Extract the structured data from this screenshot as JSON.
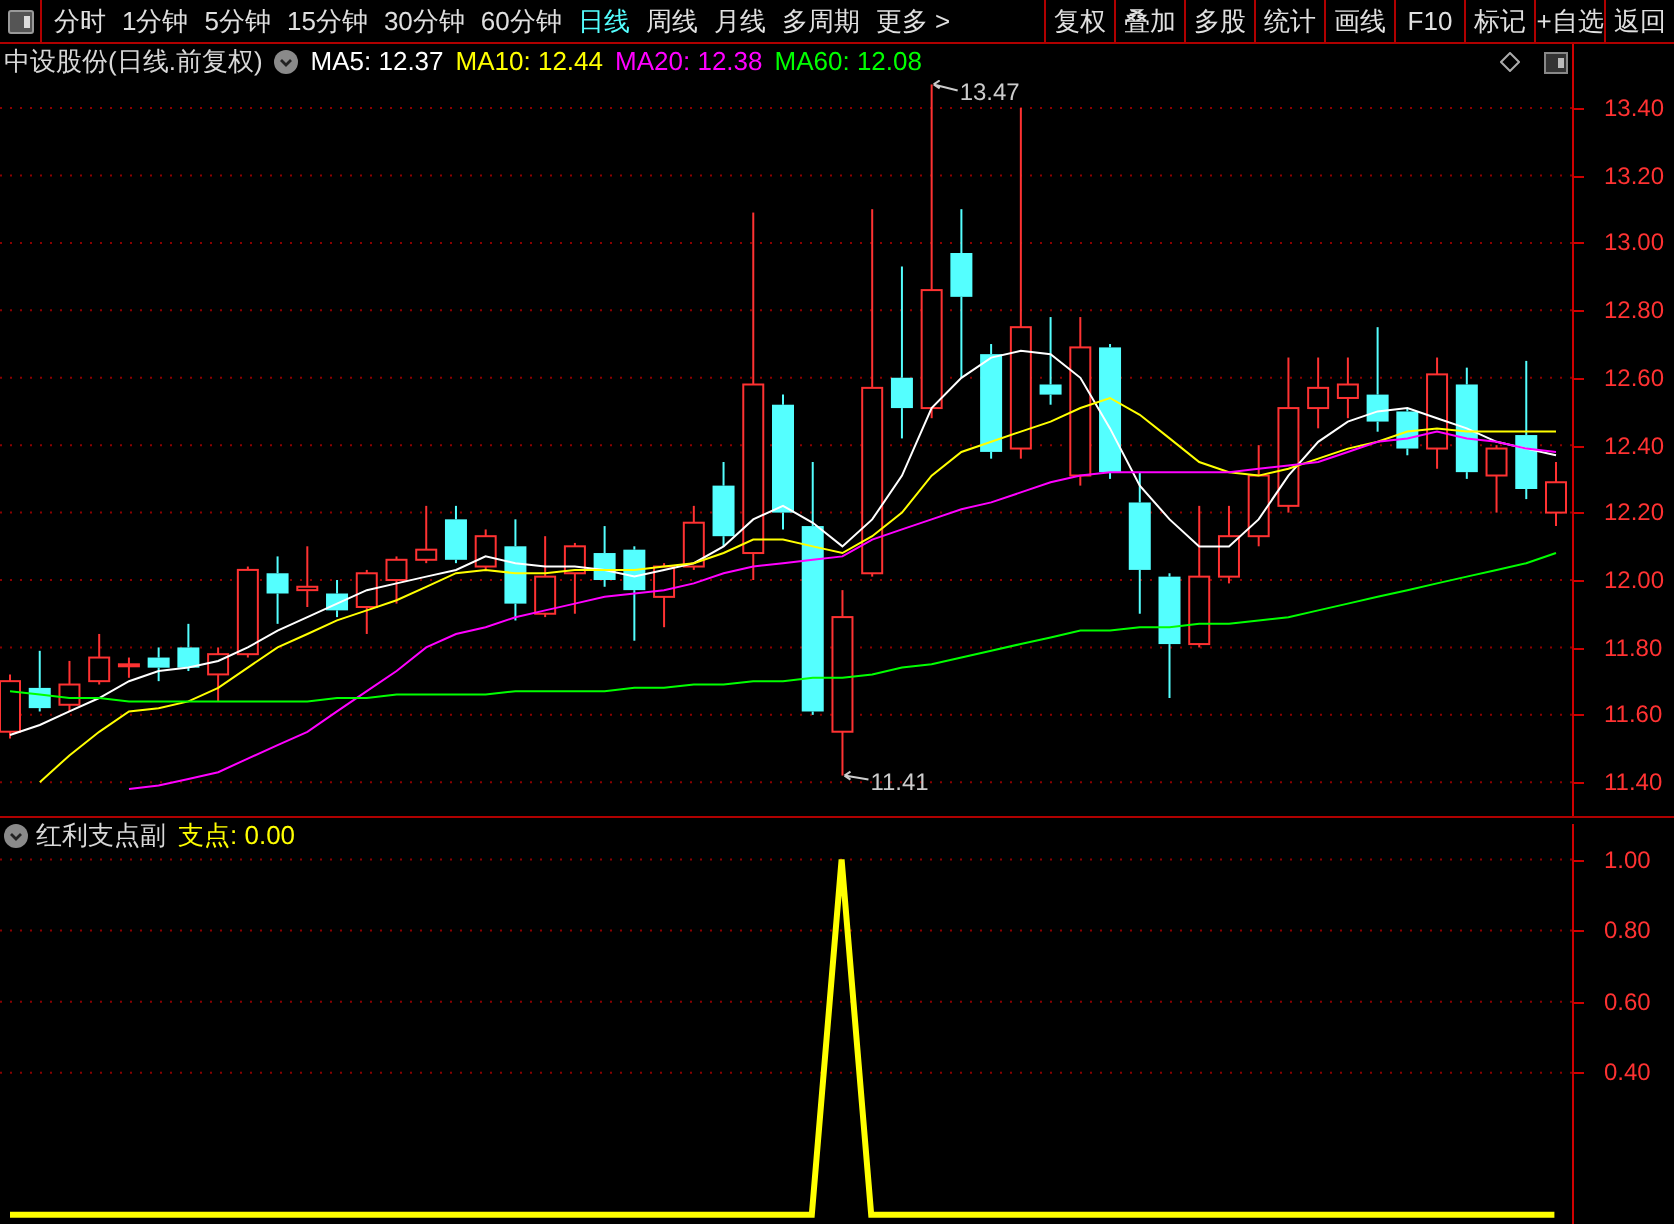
{
  "toolbar": {
    "periods": [
      {
        "label": "分时",
        "selected": false
      },
      {
        "label": "1分钟",
        "selected": false
      },
      {
        "label": "5分钟",
        "selected": false
      },
      {
        "label": "15分钟",
        "selected": false
      },
      {
        "label": "30分钟",
        "selected": false
      },
      {
        "label": "60分钟",
        "selected": false
      },
      {
        "label": "日线",
        "selected": true
      },
      {
        "label": "周线",
        "selected": false
      },
      {
        "label": "月线",
        "selected": false
      },
      {
        "label": "多周期",
        "selected": false
      },
      {
        "label": "更多 >",
        "selected": false
      }
    ],
    "buttons": [
      "复权",
      "叠加",
      "多股",
      "统计",
      "画线",
      "F10",
      "标记",
      "+自选",
      "返回"
    ]
  },
  "price_chart": {
    "title": "中设股份(日线.前复权)",
    "legend_values": [
      ": 12.37",
      ": 12.44",
      ": 12.38",
      ": 12.08"
    ],
    "high_label": "13.47",
    "low_label": "11.41",
    "chart_data": {
      "type": "candlestick",
      "ylim": [
        11.3,
        13.59
      ],
      "grid": true,
      "categories": [
        null,
        null,
        null,
        null,
        null,
        null,
        null,
        null,
        null,
        null,
        null,
        null,
        null,
        null,
        null,
        null,
        null,
        null,
        null,
        null,
        null,
        null,
        null,
        null,
        null,
        null,
        null,
        null,
        null,
        null,
        null,
        null,
        null,
        null,
        null,
        null,
        null,
        null,
        null,
        null,
        null,
        null,
        null,
        null,
        null,
        null,
        null,
        null,
        null,
        null,
        null,
        null,
        null
      ],
      "ohlc": [
        [
          11.55,
          11.72,
          11.53,
          11.7
        ],
        [
          11.68,
          11.79,
          11.61,
          11.62
        ],
        [
          11.63,
          11.76,
          11.61,
          11.69
        ],
        [
          11.7,
          11.84,
          11.69,
          11.77
        ],
        [
          11.75,
          11.77,
          11.71,
          11.75
        ],
        [
          11.77,
          11.8,
          11.7,
          11.74
        ],
        [
          11.8,
          11.87,
          11.73,
          11.74
        ],
        [
          11.72,
          11.8,
          11.64,
          11.78
        ],
        [
          11.78,
          12.04,
          11.77,
          12.03
        ],
        [
          12.02,
          12.07,
          11.87,
          11.96
        ],
        [
          11.97,
          12.1,
          11.92,
          11.98
        ],
        [
          11.96,
          12.0,
          11.89,
          11.91
        ],
        [
          11.92,
          12.03,
          11.84,
          12.02
        ],
        [
          12.0,
          12.07,
          11.93,
          12.06
        ],
        [
          12.06,
          12.22,
          12.05,
          12.09
        ],
        [
          12.18,
          12.22,
          12.05,
          12.06
        ],
        [
          12.04,
          12.15,
          12.03,
          12.13
        ],
        [
          12.1,
          12.18,
          11.88,
          11.93
        ],
        [
          11.9,
          12.13,
          11.89,
          12.01
        ],
        [
          12.02,
          12.11,
          11.9,
          12.1
        ],
        [
          12.08,
          12.16,
          11.98,
          12.0
        ],
        [
          12.09,
          12.1,
          11.82,
          11.97
        ],
        [
          11.95,
          12.05,
          11.86,
          12.04
        ],
        [
          12.04,
          12.22,
          12.03,
          12.17
        ],
        [
          12.28,
          12.35,
          12.1,
          12.13
        ],
        [
          12.08,
          13.09,
          12.0,
          12.58
        ],
        [
          12.52,
          12.55,
          12.15,
          12.2
        ],
        [
          12.16,
          12.35,
          11.6,
          11.61
        ],
        [
          11.55,
          11.97,
          11.42,
          11.89
        ],
        [
          12.02,
          13.1,
          12.01,
          12.57
        ],
        [
          12.6,
          12.93,
          12.42,
          12.51
        ],
        [
          12.51,
          13.47,
          12.48,
          12.86
        ],
        [
          12.97,
          13.1,
          12.6,
          12.84
        ],
        [
          12.67,
          12.7,
          12.36,
          12.38
        ],
        [
          12.39,
          13.4,
          12.36,
          12.75
        ],
        [
          12.58,
          12.78,
          12.52,
          12.55
        ],
        [
          12.31,
          12.78,
          12.28,
          12.69
        ],
        [
          12.69,
          12.7,
          12.3,
          12.32
        ],
        [
          12.23,
          12.32,
          11.9,
          12.03
        ],
        [
          12.01,
          12.02,
          11.65,
          11.81
        ],
        [
          11.81,
          12.22,
          11.8,
          12.01
        ],
        [
          12.01,
          12.22,
          11.99,
          12.13
        ],
        [
          12.13,
          12.4,
          12.1,
          12.31
        ],
        [
          12.22,
          12.66,
          12.2,
          12.51
        ],
        [
          12.51,
          12.66,
          12.45,
          12.57
        ],
        [
          12.54,
          12.66,
          12.48,
          12.58
        ],
        [
          12.55,
          12.75,
          12.44,
          12.47
        ],
        [
          12.5,
          12.51,
          12.37,
          12.39
        ],
        [
          12.39,
          12.66,
          12.33,
          12.61
        ],
        [
          12.58,
          12.63,
          12.3,
          12.32
        ],
        [
          12.31,
          12.4,
          12.2,
          12.39
        ],
        [
          12.43,
          12.65,
          12.24,
          12.27
        ],
        [
          12.2,
          12.35,
          12.16,
          12.29
        ]
      ],
      "series": [
        {
          "name": "MA5",
          "type": "line",
          "color": "#ffffff",
          "values": [
            11.54,
            11.57,
            11.61,
            11.65,
            11.7,
            11.73,
            11.74,
            11.76,
            11.8,
            11.85,
            11.89,
            11.93,
            11.97,
            11.99,
            12.01,
            12.03,
            12.07,
            12.05,
            12.04,
            12.04,
            12.03,
            12.01,
            12.03,
            12.05,
            12.1,
            12.18,
            12.22,
            12.17,
            12.1,
            12.18,
            12.31,
            12.51,
            12.6,
            12.66,
            12.68,
            12.67,
            12.6,
            12.45,
            12.28,
            12.18,
            12.1,
            12.1,
            12.18,
            12.31,
            12.41,
            12.47,
            12.5,
            12.51,
            12.48,
            12.45,
            12.41,
            12.39,
            12.37
          ]
        },
        {
          "name": "MA10",
          "type": "line",
          "color": "#ffff00",
          "values": [
            null,
            11.4,
            11.48,
            11.55,
            11.61,
            11.62,
            11.64,
            11.68,
            11.74,
            11.8,
            11.84,
            11.88,
            11.91,
            11.94,
            11.98,
            12.02,
            12.03,
            12.02,
            12.02,
            12.03,
            12.03,
            12.03,
            12.04,
            12.05,
            12.08,
            12.12,
            12.12,
            12.1,
            12.08,
            12.13,
            12.2,
            12.31,
            12.38,
            12.41,
            12.44,
            12.47,
            12.51,
            12.54,
            12.49,
            12.42,
            12.35,
            12.32,
            12.31,
            12.33,
            12.36,
            12.39,
            12.41,
            12.44,
            12.45,
            12.44,
            12.44,
            12.44,
            12.44
          ]
        },
        {
          "name": "MA20",
          "type": "line",
          "color": "#ff00ff",
          "values": [
            null,
            null,
            null,
            null,
            11.38,
            11.39,
            11.41,
            11.43,
            11.47,
            11.51,
            11.55,
            11.61,
            11.67,
            11.73,
            11.8,
            11.84,
            11.86,
            11.89,
            11.91,
            11.93,
            11.95,
            11.96,
            11.97,
            11.99,
            12.02,
            12.04,
            12.05,
            12.06,
            12.07,
            12.12,
            12.15,
            12.18,
            12.21,
            12.23,
            12.26,
            12.29,
            12.31,
            12.32,
            12.32,
            12.32,
            12.32,
            12.32,
            12.33,
            12.34,
            12.35,
            12.38,
            12.41,
            12.42,
            12.44,
            12.42,
            12.41,
            12.39,
            12.38
          ]
        },
        {
          "name": "MA60",
          "type": "line",
          "color": "#00ff00",
          "values": [
            11.67,
            11.66,
            11.65,
            11.65,
            11.64,
            11.64,
            11.64,
            11.64,
            11.64,
            11.64,
            11.64,
            11.65,
            11.65,
            11.66,
            11.66,
            11.66,
            11.66,
            11.67,
            11.67,
            11.67,
            11.67,
            11.68,
            11.68,
            11.69,
            11.69,
            11.7,
            11.7,
            11.71,
            11.71,
            11.72,
            11.74,
            11.75,
            11.77,
            11.79,
            11.81,
            11.83,
            11.85,
            11.85,
            11.86,
            11.86,
            11.87,
            11.87,
            11.88,
            11.89,
            11.91,
            11.93,
            11.95,
            11.97,
            11.99,
            12.01,
            12.03,
            12.05,
            12.08
          ]
        }
      ],
      "yticks": [
        {
          "value": 13.4,
          "label": "13.40"
        },
        {
          "value": 13.2,
          "label": "13.20"
        },
        {
          "value": 13.0,
          "label": "13.00"
        },
        {
          "value": 12.8,
          "label": "12.80"
        },
        {
          "value": 12.6,
          "label": "12.60"
        },
        {
          "value": 12.4,
          "label": "12.40"
        },
        {
          "value": 12.2,
          "label": "12.20"
        },
        {
          "value": 12.0,
          "label": "12.00"
        },
        {
          "value": 11.8,
          "label": "11.80"
        },
        {
          "value": 11.6,
          "label": "11.60"
        },
        {
          "value": 11.4,
          "label": "11.40"
        }
      ]
    }
  },
  "indicator_panel": {
    "title": "红利支点副",
    "reading_value": ": 0.00",
    "chart_data": {
      "type": "line",
      "grid": true,
      "series": [
        {
          "name": "支点",
          "color": "#ffff00",
          "values": [
            0,
            0,
            0,
            0,
            0,
            0,
            0,
            0,
            0,
            0,
            0,
            0,
            0,
            0,
            0,
            0,
            0,
            0,
            0,
            0,
            0,
            0,
            0,
            0,
            0,
            0,
            0,
            0,
            1,
            0,
            0,
            0,
            0,
            0,
            0,
            0,
            0,
            0,
            0,
            0,
            0,
            0,
            0,
            0,
            0,
            0,
            0,
            0,
            0,
            0,
            0,
            0,
            0
          ]
        }
      ],
      "ylim": [
        -0.02,
        1.1
      ],
      "yticks": [
        {
          "value": 1,
          "label": "1.00"
        },
        {
          "value": 0.8,
          "label": "0.80"
        },
        {
          "value": 0.6,
          "label": "0.60"
        },
        {
          "value": 0.4,
          "label": "0.40"
        }
      ]
    }
  }
}
